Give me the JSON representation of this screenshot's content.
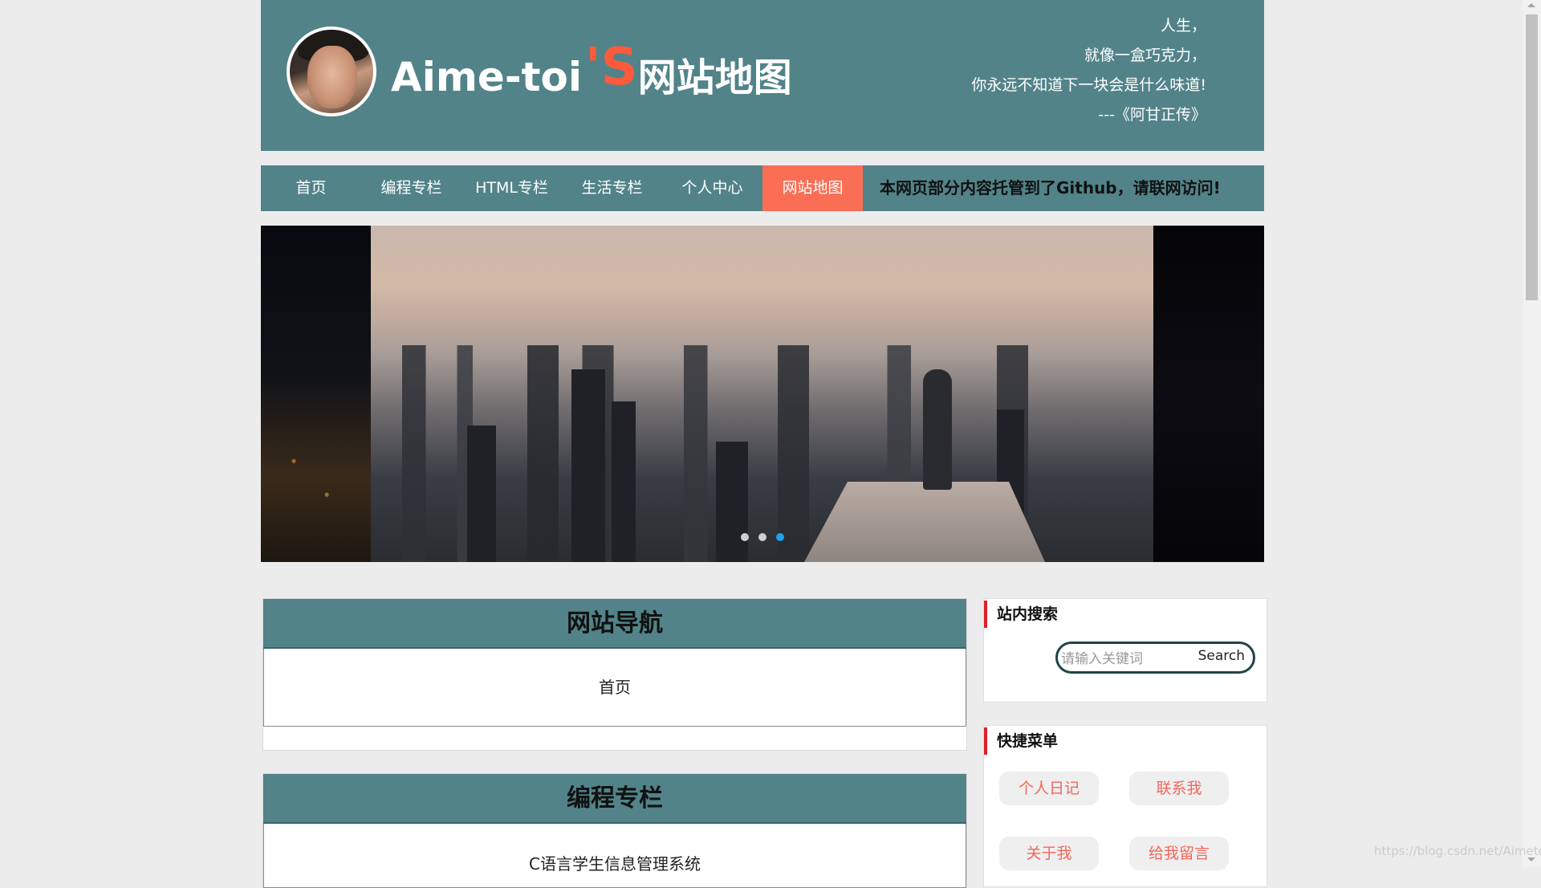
{
  "header": {
    "title_main": "Aime-toi",
    "title_apostrophe": "'S",
    "title_suffix": "网站地图",
    "quote_lines": [
      "人生，",
      "就像一盒巧克力，",
      "你永远不知道下一块会是什么味道!",
      "---《阿甘正传》"
    ]
  },
  "nav": {
    "items": [
      {
        "label": "首页",
        "active": false
      },
      {
        "label": "编程专栏",
        "active": false
      },
      {
        "label": "HTML专栏",
        "active": false
      },
      {
        "label": "生活专栏",
        "active": false
      },
      {
        "label": "个人中心",
        "active": false
      },
      {
        "label": "网站地图",
        "active": true
      }
    ],
    "notice": "本网页部分内容托管到了Github，请联网访问!"
  },
  "carousel": {
    "slide_count": 3,
    "active_slide": 3
  },
  "sections": [
    {
      "title": "网站导航",
      "items": [
        "首页"
      ]
    },
    {
      "title": "编程专栏",
      "items": [
        "C语言学生信息管理系统"
      ]
    }
  ],
  "sidebar": {
    "search": {
      "title": "站内搜索",
      "placeholder": "请输入关键词",
      "button_label": "Search"
    },
    "quick_menu": {
      "title": "快捷菜单",
      "items": [
        "个人日记",
        "联系我",
        "关于我",
        "给我留言"
      ]
    }
  },
  "watermark": "https://blog.csdn.net/Aimetoi",
  "colors": {
    "header_bg": "#528389",
    "accent": "#fa6e55",
    "active_dot": "#1aa3e8",
    "quick_text": "#f2675b",
    "sidebar_marker": "#e0202a"
  }
}
